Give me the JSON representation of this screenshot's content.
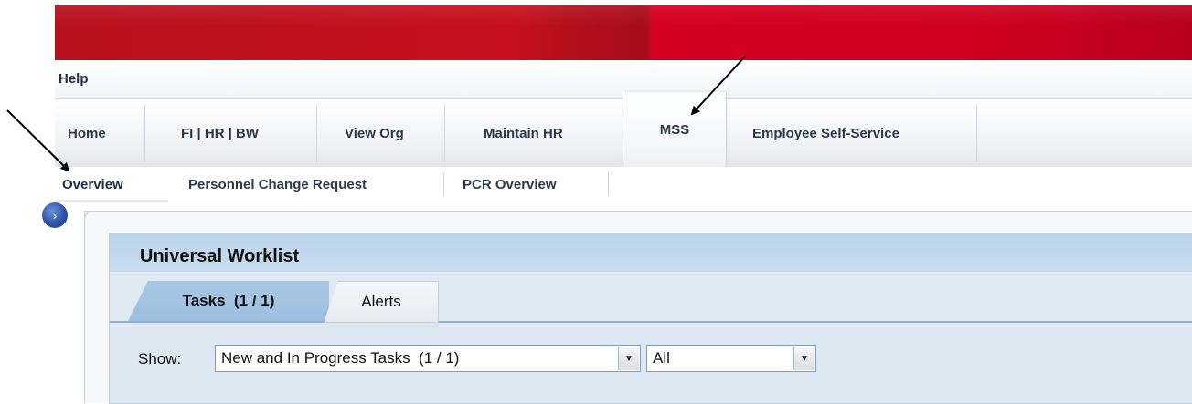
{
  "help_bar": {
    "help_label": "Help"
  },
  "top_nav": {
    "tabs": [
      {
        "label": "Home"
      },
      {
        "label": "FI | HR | BW"
      },
      {
        "label": "View Org"
      },
      {
        "label": "Maintain HR"
      },
      {
        "label": "MSS"
      },
      {
        "label": "Employee Self-Service"
      }
    ],
    "active_tab": "MSS"
  },
  "sub_nav": {
    "tabs": [
      {
        "label": "Overview"
      },
      {
        "label": "Personnel Change Request"
      },
      {
        "label": "PCR Overview"
      }
    ],
    "active_tab": "Overview"
  },
  "nav_toggle": {
    "icon": "chevron-right-icon",
    "glyph": "›"
  },
  "worklist": {
    "title": "Universal Worklist",
    "tabs": [
      {
        "label": "Tasks  (1 / 1)"
      },
      {
        "label": "Alerts"
      }
    ],
    "active_tab": "Tasks  (1 / 1)",
    "filter": {
      "show_label": "Show:",
      "status_value": "New and In Progress Tasks  (1 / 1)",
      "scope_value": "All",
      "dropdown_glyph": "▼"
    }
  },
  "colors": {
    "banner_red": "#c8101e",
    "panel_header": "#b9d3ea",
    "active_tab_blue": "#a9c7e4"
  }
}
